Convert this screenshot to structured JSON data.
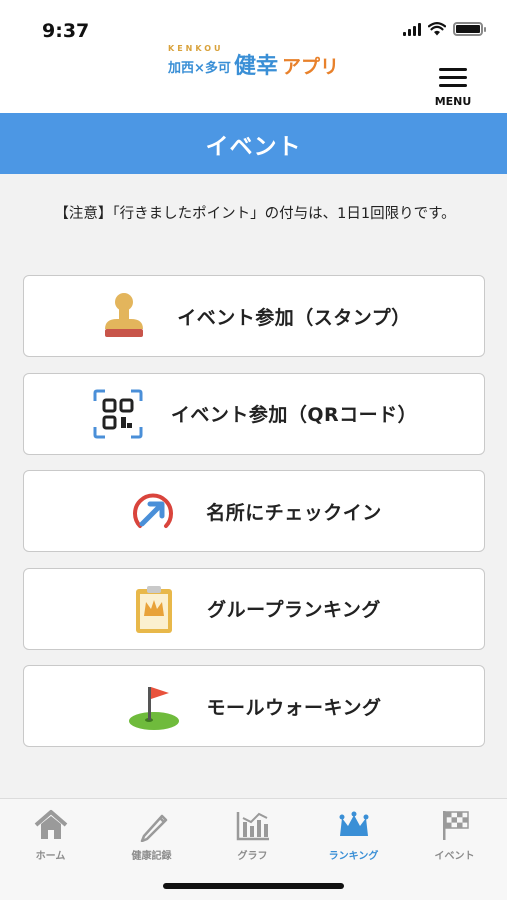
{
  "status_bar": {
    "time": "9:37"
  },
  "header": {
    "logo": {
      "small": "KENKOU",
      "town": "加西×多可",
      "main": "健幸",
      "app": "アプリ"
    },
    "menu_label": "MENU"
  },
  "page": {
    "title": "イベント",
    "notice": "【注意】「行きましたポイント」の付与は、1日1回限りです。"
  },
  "menu_items": [
    {
      "label": "イベント参加（スタンプ）",
      "icon": "stamp-icon"
    },
    {
      "label": "イベント参加（QRコード）",
      "icon": "qr-scan-icon"
    },
    {
      "label": "名所にチェックイン",
      "icon": "check-in-icon"
    },
    {
      "label": "グループランキング",
      "icon": "crown-clipboard-icon"
    },
    {
      "label": "モールウォーキング",
      "icon": "flag-green-icon"
    }
  ],
  "tabs": [
    {
      "label": "ホーム",
      "icon": "home-icon",
      "active": false
    },
    {
      "label": "健康記録",
      "icon": "pencil-icon",
      "active": false
    },
    {
      "label": "グラフ",
      "icon": "graph-icon",
      "active": false
    },
    {
      "label": "ランキング",
      "icon": "crown-icon",
      "active": true
    },
    {
      "label": "イベント",
      "icon": "checkered-flag-icon",
      "active": false
    }
  ],
  "colors": {
    "accent": "#4c97e4",
    "tab_active": "#3a8fd6",
    "tab_inactive": "#8c8c8c"
  }
}
